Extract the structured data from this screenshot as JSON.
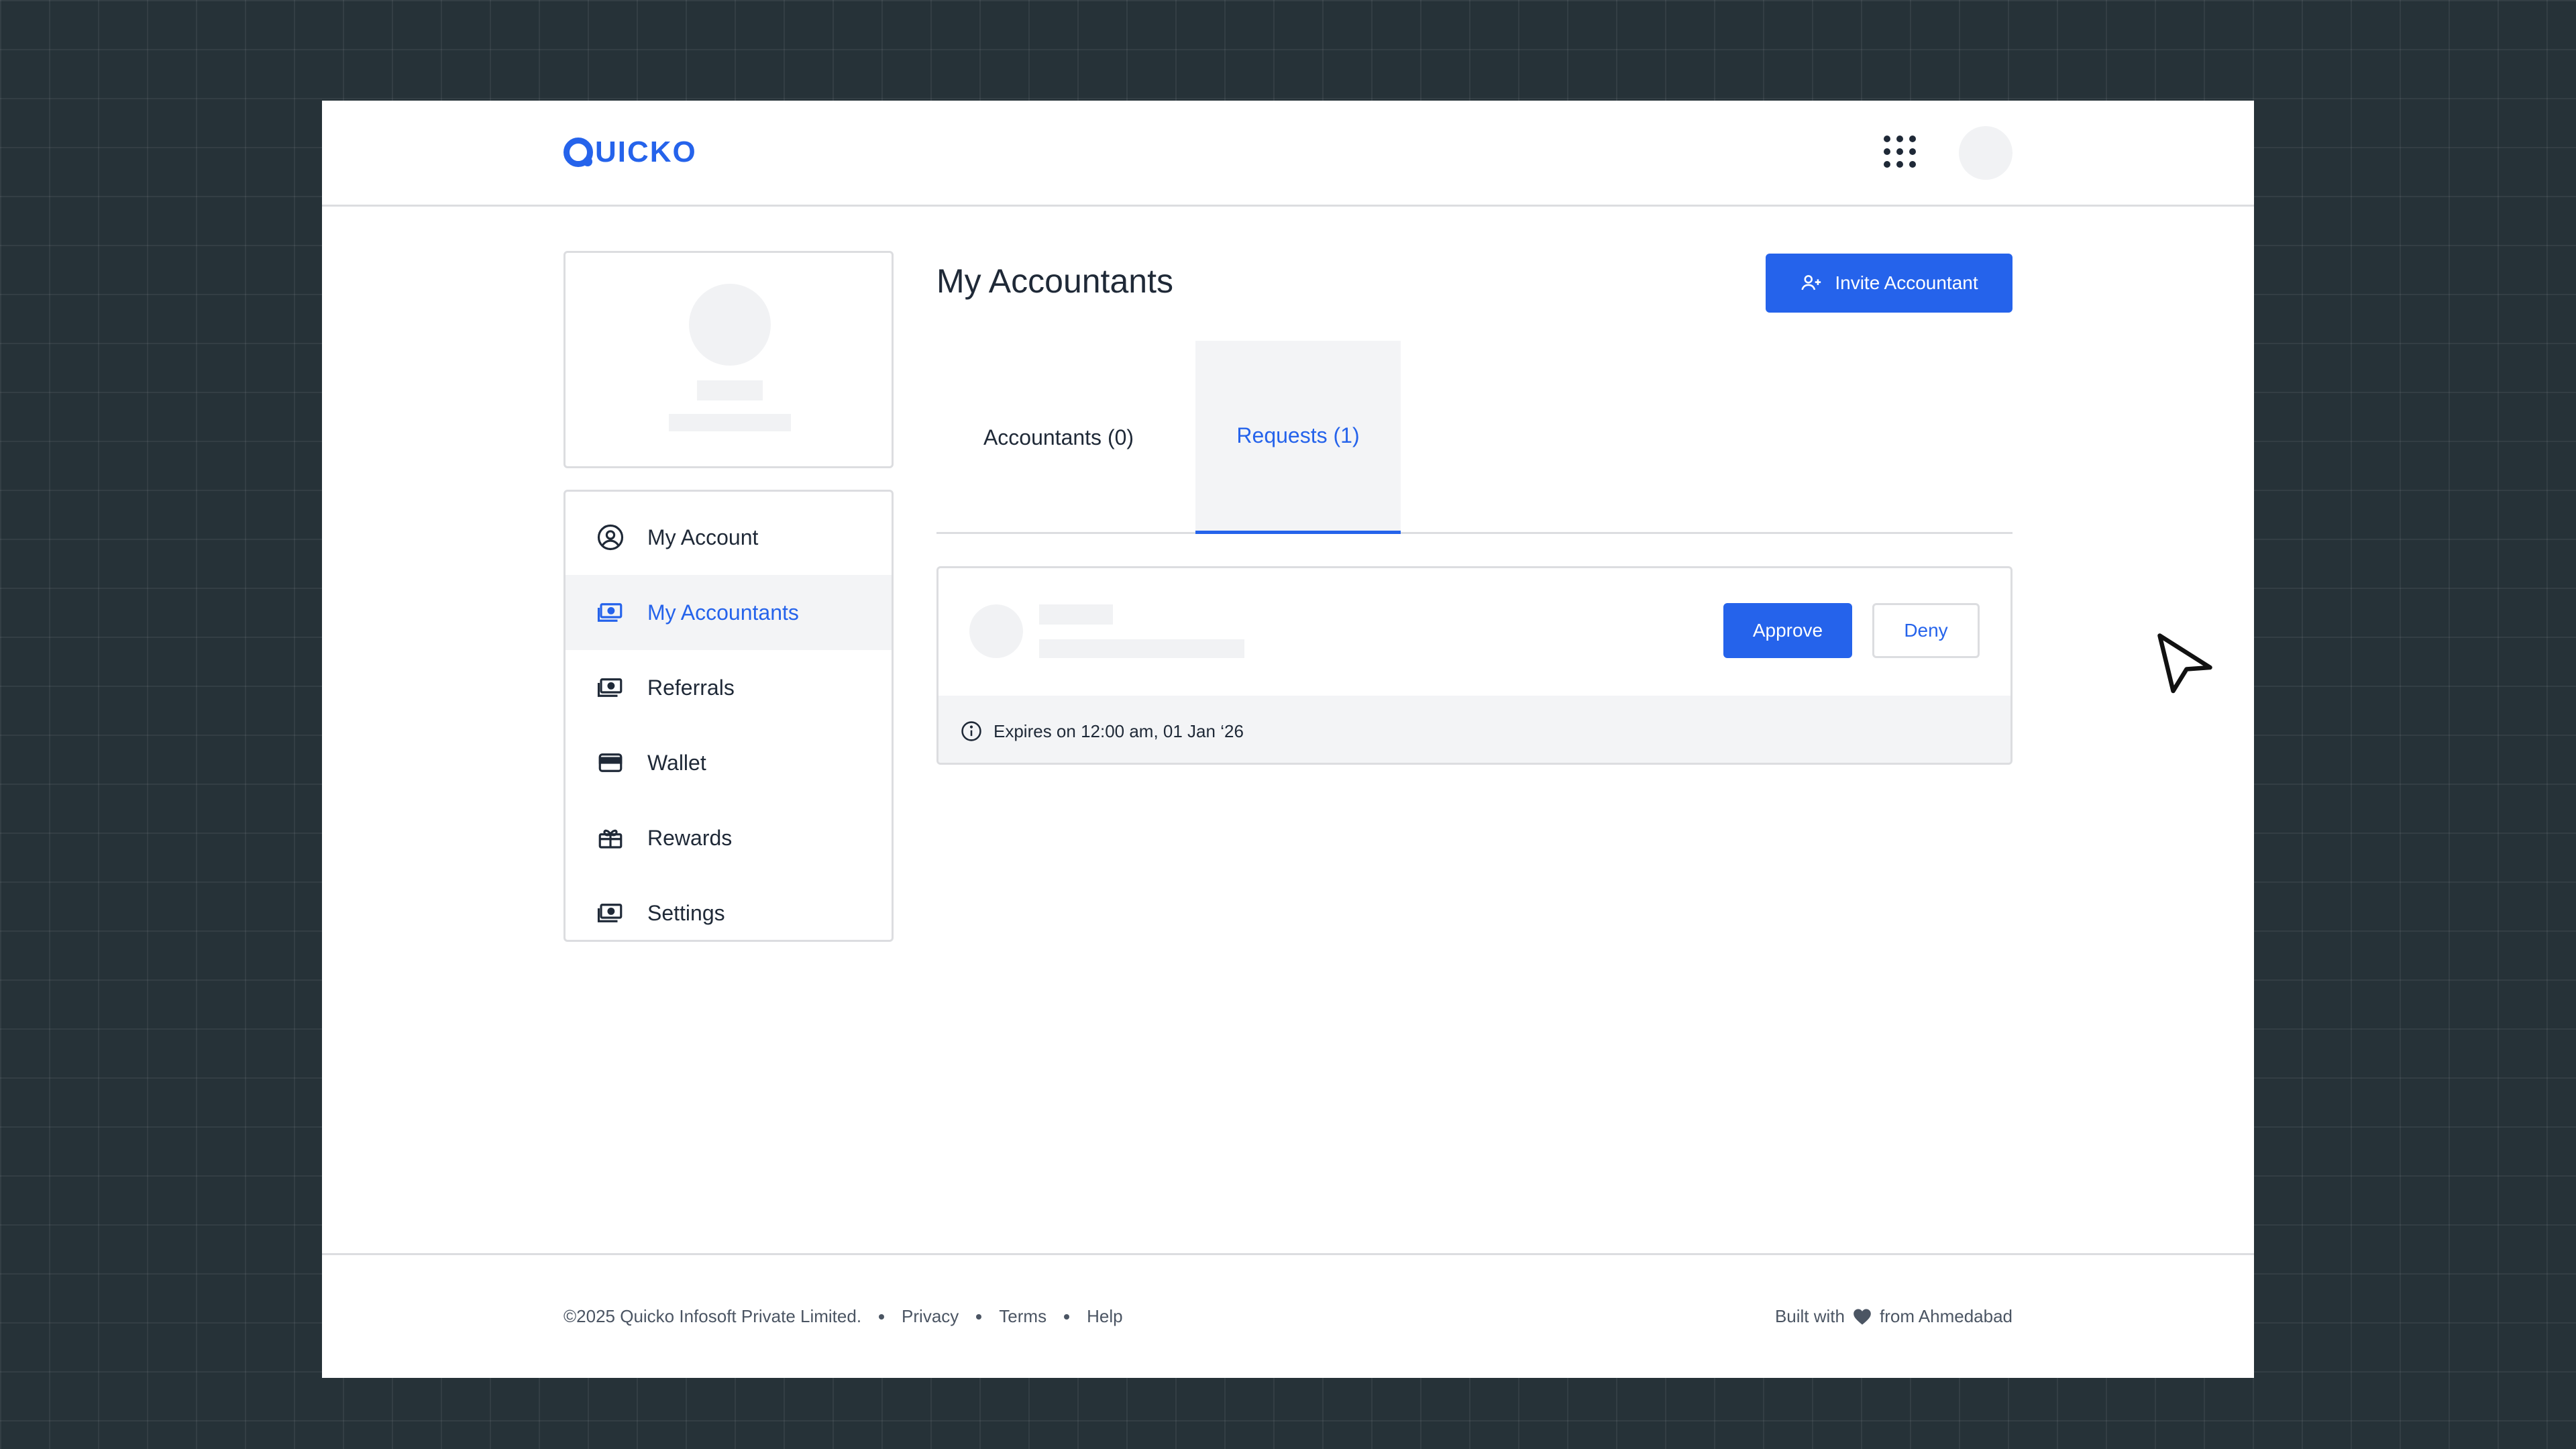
{
  "brand": {
    "logo_text": "UICKO",
    "logo_full": "QUICKO",
    "color": "#2563eb"
  },
  "header": {
    "apps_icon": "grid-icon",
    "avatar": "avatar-placeholder"
  },
  "sidebar": {
    "items": [
      {
        "label": "My Account",
        "icon": "user-circle-icon",
        "active": false
      },
      {
        "label": "My Accountants",
        "icon": "banknote-icon",
        "active": true
      },
      {
        "label": "Referrals",
        "icon": "banknote-icon",
        "active": false
      },
      {
        "label": "Wallet",
        "icon": "wallet-icon",
        "active": false
      },
      {
        "label": "Rewards",
        "icon": "gift-icon",
        "active": false
      },
      {
        "label": "Settings",
        "icon": "banknote-icon",
        "active": false
      }
    ]
  },
  "main": {
    "title": "My Accountants",
    "invite_button": "Invite Accountant",
    "tabs": [
      {
        "label": "Accountants (0)",
        "active": false
      },
      {
        "label": "Requests (1)",
        "active": true
      }
    ],
    "request": {
      "approve_label": "Approve",
      "deny_label": "Deny",
      "expiry_text": "Expires on 12:00 am, 01 Jan ‘26"
    }
  },
  "footer": {
    "copyright": "©2025 Quicko Infosoft Private Limited.",
    "links": [
      "Privacy",
      "Terms",
      "Help"
    ],
    "built_with": "Built with",
    "from": "from Ahmedabad"
  }
}
